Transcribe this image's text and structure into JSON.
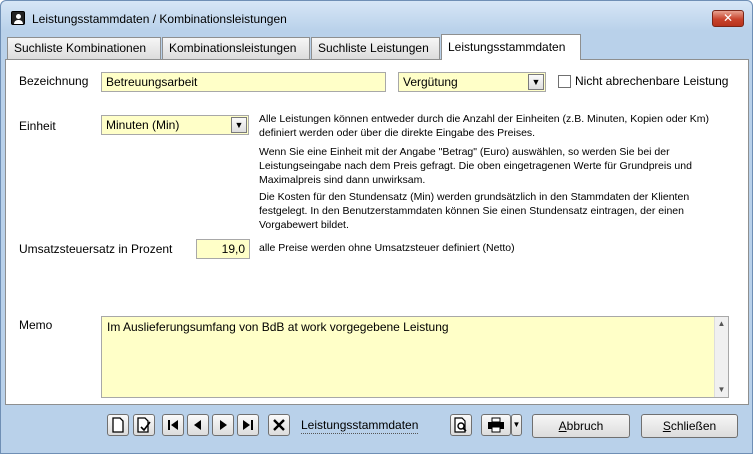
{
  "window": {
    "title": "Leistungsstammdaten / Kombinationsleistungen",
    "close_glyph": "✕"
  },
  "tabs": [
    {
      "label": "Suchliste Kombinationen"
    },
    {
      "label": "Kombinationsleistungen"
    },
    {
      "label": "Suchliste Leistungen"
    },
    {
      "label": "Leistungsstammdaten",
      "active": true
    }
  ],
  "form": {
    "bezeichnung_label": "Bezeichnung",
    "bezeichnung_value": "Betreuungsarbeit",
    "verguetung_value": "Vergütung",
    "nicht_abrechenbar_label": "Nicht abrechenbare Leistung",
    "nicht_abrechenbar_checked": false,
    "einheit_label": "Einheit",
    "einheit_value": "Minuten (Min)",
    "info_1": "Alle Leistungen können entweder durch die Anzahl der Einheiten (z.B. Minuten, Kopien oder Km) definiert werden oder über die direkte Eingabe des Preises.",
    "info_2": "Wenn Sie eine Einheit mit der Angabe \"Betrag\" (Euro) auswählen, so werden Sie bei der Leistungseingabe nach dem Preis gefragt. Die oben eingetragenen Werte für Grundpreis und Maximalpreis sind dann unwirksam.",
    "info_3": "Die Kosten für den Stundensatz (Min) werden grundsätzlich in den Stammdaten der Klienten festgelegt. In den Benutzerstammdaten können Sie einen Stundensatz eintragen, der einen Vorgabewert bildet.",
    "ust_label": "Umsatzsteuersatz in Prozent",
    "ust_value": "19,0",
    "ust_note": "alle Preise werden ohne Umsatzsteuer definiert (Netto)",
    "memo_label": "Memo",
    "memo_value": "Im Auslieferungsumfang von BdB at work vorgegebene Leistung"
  },
  "toolbar": {
    "nav_label": "Leistungsstammdaten",
    "abbruch_prefix": "",
    "abbruch_key": "A",
    "abbruch_rest": "bbruch",
    "schliessen_prefix": "",
    "schliessen_key": "S",
    "schliessen_rest": "chließen"
  },
  "colors": {
    "field_bg": "#ffffc8",
    "window_bg": "#b9d1ea",
    "close_red": "#c8432c"
  }
}
